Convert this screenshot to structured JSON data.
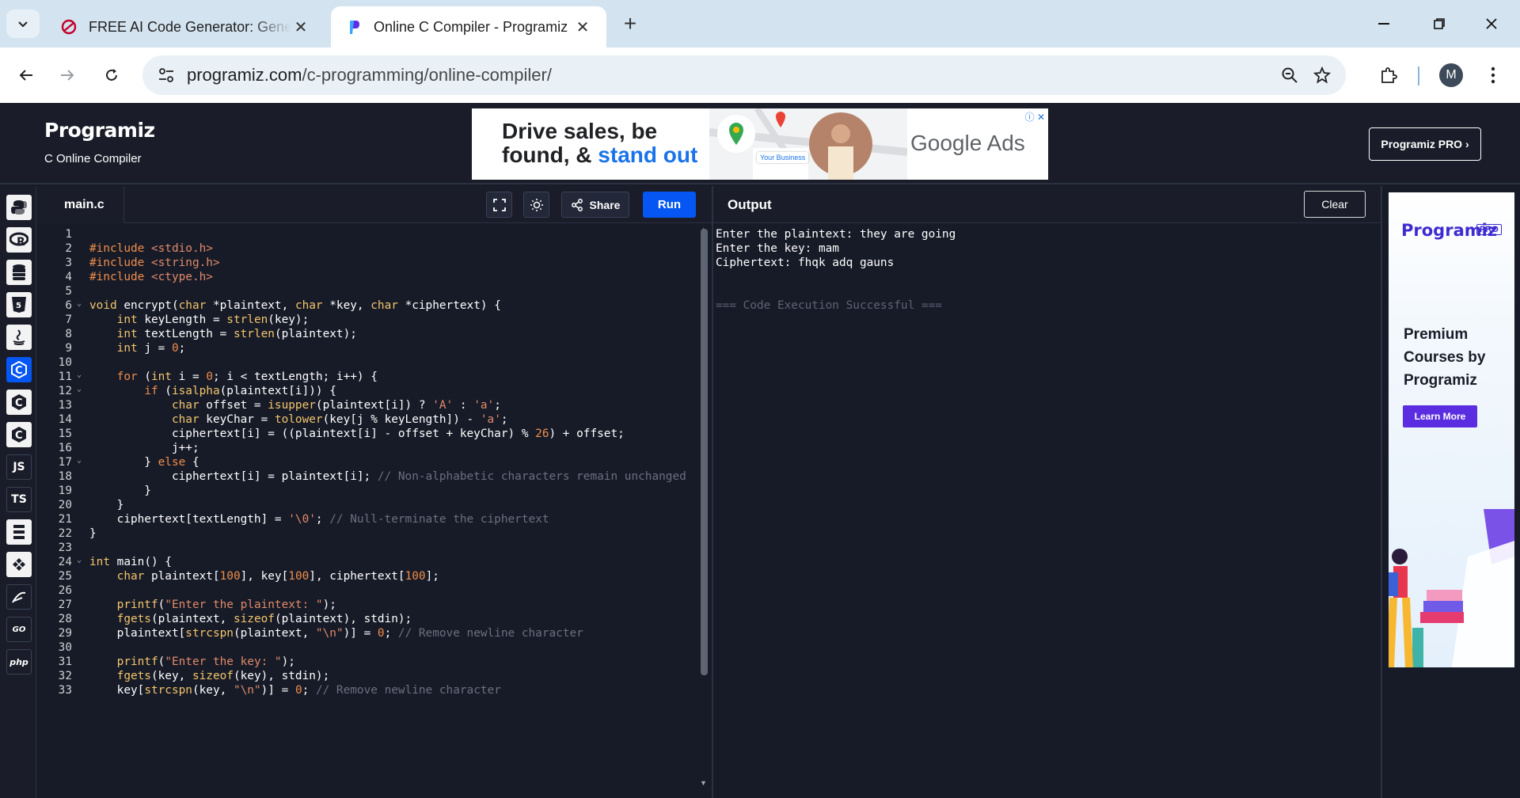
{
  "browser": {
    "tabs": [
      {
        "title": "FREE AI Code Generator: Generate Code",
        "icon": "ai-generator-favicon"
      },
      {
        "title": "Online C Compiler - Programiz",
        "icon": "programiz-favicon"
      }
    ],
    "close_glyph": "✕",
    "new_tab_glyph": "+",
    "window_controls": {
      "minimize": "—",
      "restore": "❐",
      "close": "✕"
    },
    "url_host": "programiz.com",
    "url_path": "/c-programming/online-compiler/",
    "profile_initial": "M"
  },
  "header": {
    "logo": "Programiz",
    "subtitle": "C Online Compiler",
    "pro_button": "Programiz PRO ›"
  },
  "ad_banner": {
    "headline_line1": "Drive sales, be",
    "headline_line2_a": "found, & ",
    "headline_line2_b": "stand out",
    "brand": "Google Ads",
    "business_card": "Your Business",
    "close": "ⓘ ✕"
  },
  "rail": {
    "items": [
      {
        "name": "python",
        "label": ""
      },
      {
        "name": "r",
        "label": "R"
      },
      {
        "name": "sql",
        "label": ""
      },
      {
        "name": "html",
        "label": "5"
      },
      {
        "name": "java",
        "label": ""
      },
      {
        "name": "c",
        "label": "C",
        "active": true
      },
      {
        "name": "cpp",
        "label": "C"
      },
      {
        "name": "csharp",
        "label": "C"
      },
      {
        "name": "javascript",
        "label": "JS"
      },
      {
        "name": "typescript",
        "label": "TS"
      },
      {
        "name": "dart",
        "label": ""
      },
      {
        "name": "ruby",
        "label": ""
      },
      {
        "name": "swift",
        "label": ""
      },
      {
        "name": "go",
        "label": "GO"
      },
      {
        "name": "php",
        "label": "php"
      }
    ]
  },
  "editor": {
    "filename": "main.c",
    "share_label": "Share",
    "run_label": "Run",
    "lines": [
      {
        "n": "1",
        "html": ""
      },
      {
        "n": "2",
        "html": "<span class='pp'>#include</span> <span class='str'>&lt;stdio.h&gt;</span>"
      },
      {
        "n": "3",
        "html": "<span class='pp'>#include</span> <span class='str'>&lt;string.h&gt;</span>"
      },
      {
        "n": "4",
        "html": "<span class='pp'>#include</span> <span class='str'>&lt;ctype.h&gt;</span>"
      },
      {
        "n": "5",
        "html": ""
      },
      {
        "n": "6",
        "fold": true,
        "html": "<span class='typ'>void</span> encrypt(<span class='typ'>char</span> *plaintext, <span class='typ'>char</span> *key, <span class='typ'>char</span> *ciphertext) {"
      },
      {
        "n": "7",
        "html": "    <span class='typ'>int</span> keyLength = <span class='fn'>strlen</span>(key);"
      },
      {
        "n": "8",
        "html": "    <span class='typ'>int</span> textLength = <span class='fn'>strlen</span>(plaintext);"
      },
      {
        "n": "9",
        "html": "    <span class='typ'>int</span> j = <span class='num'>0</span>;"
      },
      {
        "n": "10",
        "html": ""
      },
      {
        "n": "11",
        "fold": true,
        "html": "    <span class='kw'>for</span> (<span class='typ'>int</span> i = <span class='num'>0</span>; i &lt; textLength; i++) {"
      },
      {
        "n": "12",
        "fold": true,
        "html": "        <span class='kw'>if</span> (<span class='fn'>isalpha</span>(plaintext[i])) {"
      },
      {
        "n": "13",
        "html": "            <span class='typ'>char</span> offset = <span class='fn'>isupper</span>(plaintext[i]) ? <span class='str'>'A'</span> : <span class='str'>'a'</span>;"
      },
      {
        "n": "14",
        "html": "            <span class='typ'>char</span> keyChar = <span class='fn'>tolower</span>(key[j % keyLength]) - <span class='str'>'a'</span>;"
      },
      {
        "n": "15",
        "html": "            ciphertext[i] = ((plaintext[i] - offset + keyChar) % <span class='num'>26</span>) + offset;"
      },
      {
        "n": "16",
        "html": "            j++;"
      },
      {
        "n": "17",
        "fold": true,
        "html": "        } <span class='kw'>else</span> {"
      },
      {
        "n": "18",
        "html": "            ciphertext[i] = plaintext[i]; <span class='cmt'>// Non-alphabetic characters remain unchanged</span>"
      },
      {
        "n": "19",
        "html": "        }"
      },
      {
        "n": "20",
        "html": "    }"
      },
      {
        "n": "21",
        "html": "    ciphertext[textLength] = <span class='str'>'\\0'</span>; <span class='cmt'>// Null-terminate the ciphertext</span>"
      },
      {
        "n": "22",
        "html": "}"
      },
      {
        "n": "23",
        "html": ""
      },
      {
        "n": "24",
        "fold": true,
        "html": "<span class='typ'>int</span> main() {"
      },
      {
        "n": "25",
        "html": "    <span class='typ'>char</span> plaintext[<span class='num'>100</span>], key[<span class='num'>100</span>], ciphertext[<span class='num'>100</span>];"
      },
      {
        "n": "26",
        "html": ""
      },
      {
        "n": "27",
        "html": "    <span class='fn'>printf</span>(<span class='str'>\"Enter the plaintext: \"</span>);"
      },
      {
        "n": "28",
        "html": "    <span class='fn'>fgets</span>(plaintext, <span class='fn'>sizeof</span>(plaintext), stdin);"
      },
      {
        "n": "29",
        "html": "    plaintext[<span class='fn'>strcspn</span>(plaintext, <span class='str'>\"\\n\"</span>)] = <span class='num'>0</span>; <span class='cmt'>// Remove newline character</span>"
      },
      {
        "n": "30",
        "html": ""
      },
      {
        "n": "31",
        "html": "    <span class='fn'>printf</span>(<span class='str'>\"Enter the key: \"</span>);"
      },
      {
        "n": "32",
        "html": "    <span class='fn'>fgets</span>(key, <span class='fn'>sizeof</span>(key), stdin);"
      },
      {
        "n": "33",
        "html": "    key[<span class='fn'>strcspn</span>(key, <span class='str'>\"\\n\"</span>)] = <span class='num'>0</span>; <span class='cmt'>// Remove newline character</span>"
      }
    ]
  },
  "output": {
    "title": "Output",
    "clear_label": "Clear",
    "lines": [
      "Enter the plaintext: they are going",
      "Enter the key: mam",
      "Ciphertext: fhqk adq gauns",
      "",
      "",
      "=== Code Execution Successful ==="
    ]
  },
  "side_ad": {
    "logo": "Programiz",
    "pro_tag": "PRO",
    "text": "Premium Courses by Programiz",
    "button": "Learn More"
  },
  "colors": {
    "accent": "#0556f3",
    "bg": "#171b28",
    "panel": "#1a1d29",
    "side_ad_accent": "#5a2ee0"
  }
}
